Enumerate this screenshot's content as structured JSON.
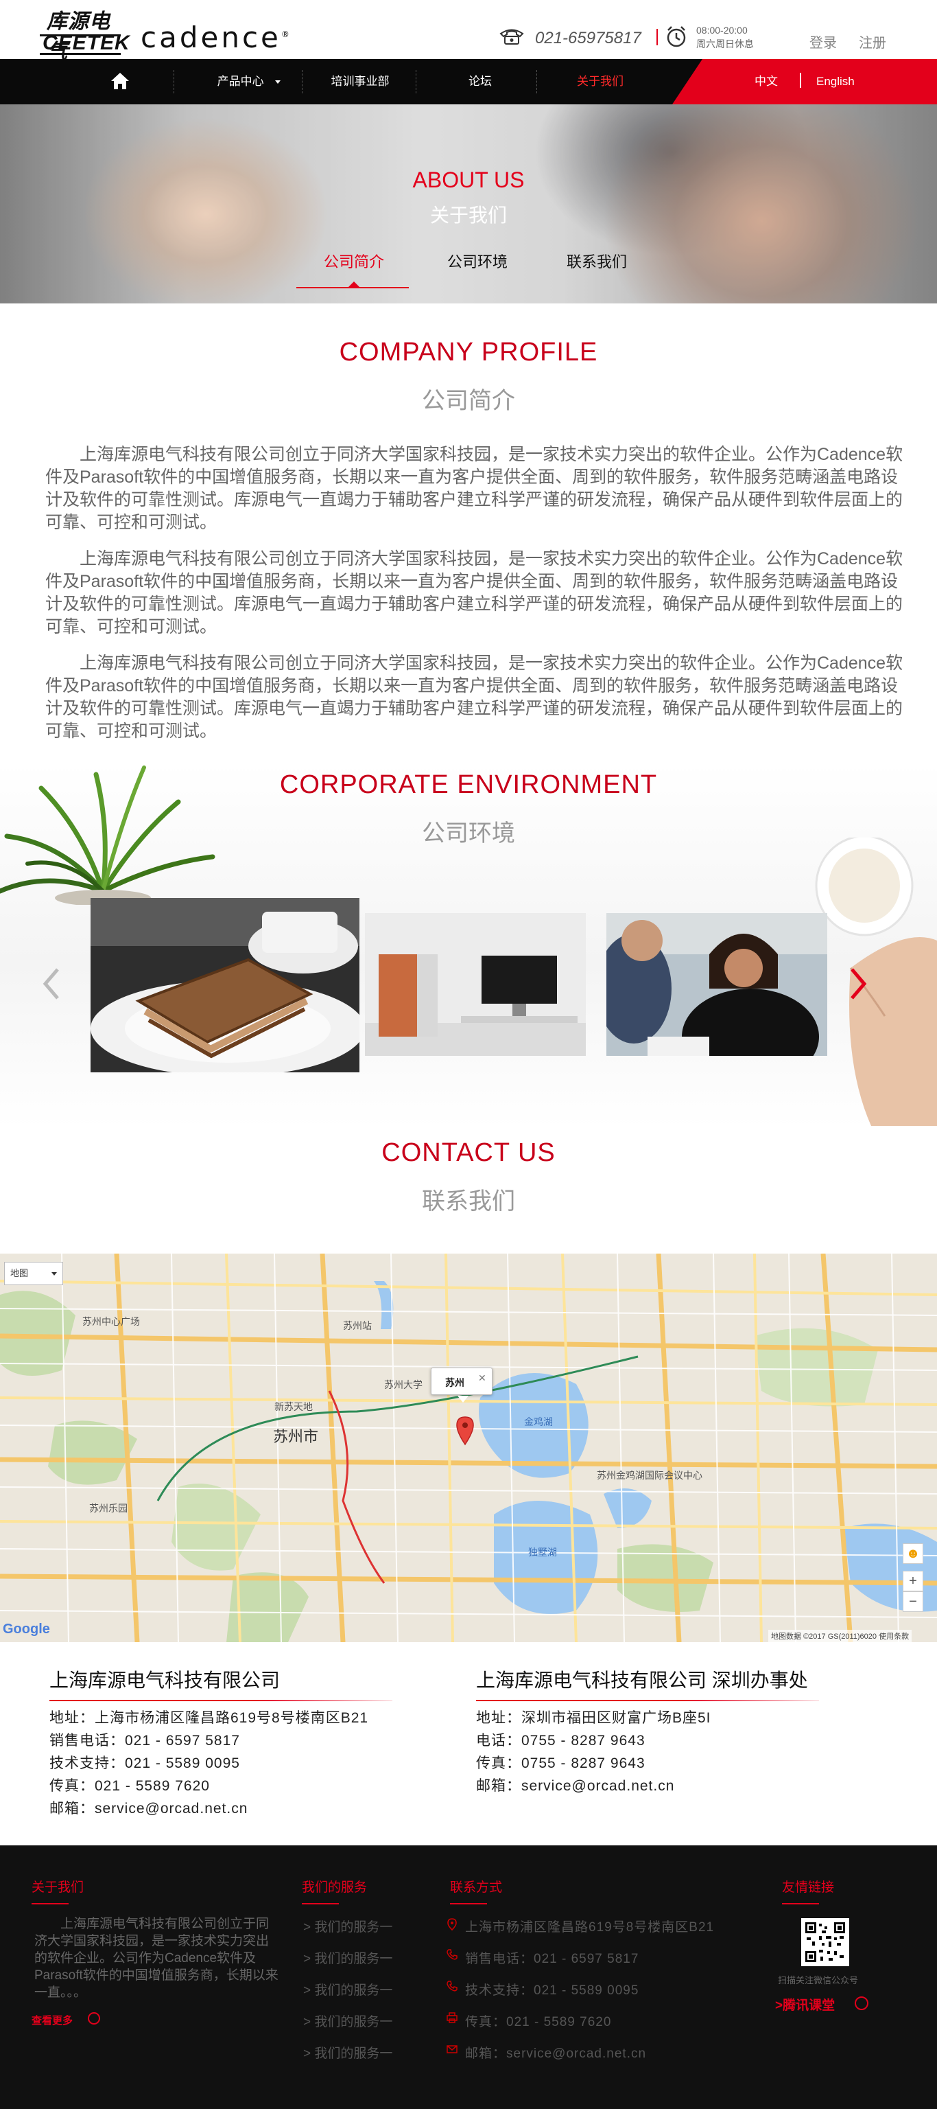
{
  "header": {
    "logo_cn": "库源电气",
    "logo_en": "CEETEK",
    "partner_logo": "cadence",
    "phone": "021-65975817",
    "hours_line1": "08:00-20:00",
    "hours_line2": "周六周日休息",
    "login": "登录",
    "register": "注册"
  },
  "nav": {
    "items": [
      {
        "label": "产品中心"
      },
      {
        "label": "培训事业部"
      },
      {
        "label": "论坛"
      },
      {
        "label": "关于我们"
      }
    ],
    "lang_zh": "中文",
    "lang_en": "English"
  },
  "hero": {
    "title_en": "ABOUT US",
    "title_cn": "关于我们",
    "tabs": [
      {
        "label": "公司简介"
      },
      {
        "label": "公司环境"
      },
      {
        "label": "联系我们"
      }
    ]
  },
  "profile": {
    "title_en": "COMPANY PROFILE",
    "title_cn": "公司简介",
    "paragraphs": [
      "上海库源电气科技有限公司创立于同济大学国家科技园，是一家技术实力突出的软件企业。公作为Cadence软件及Parasoft软件的中国增值服务商，长期以来一直为客户提供全面、周到的软件服务，软件服务范畴涵盖电路设计及软件的可靠性测试。库源电气一直竭力于辅助客户建立科学严谨的研发流程，确保产品从硬件到软件层面上的可靠、可控和可测试。",
      "上海库源电气科技有限公司创立于同济大学国家科技园，是一家技术实力突出的软件企业。公作为Cadence软件及Parasoft软件的中国增值服务商，长期以来一直为客户提供全面、周到的软件服务，软件服务范畴涵盖电路设计及软件的可靠性测试。库源电气一直竭力于辅助客户建立科学严谨的研发流程，确保产品从硬件到软件层面上的可靠、可控和可测试。",
      "上海库源电气科技有限公司创立于同济大学国家科技园，是一家技术实力突出的软件企业。公作为Cadence软件及Parasoft软件的中国增值服务商，长期以来一直为客户提供全面、周到的软件服务，软件服务范畴涵盖电路设计及软件的可靠性测试。库源电气一直竭力于辅助客户建立科学严谨的研发流程，确保产品从硬件到软件层面上的可靠、可控和可测试。"
    ]
  },
  "environment": {
    "title_en": "CORPORATE ENVIRONMENT",
    "title_cn": "公司环境"
  },
  "contact": {
    "title_en": "CONTACT US",
    "title_cn": "联系我们"
  },
  "map": {
    "type_select": "地图",
    "popup": "苏州",
    "logo": "Google",
    "copyright": "地图数据 ©2017 GS(2011)6020    使用条款",
    "labels": [
      "苏州市",
      "苏州站",
      "新苏天地",
      "苏州大学",
      "金鸡湖",
      "独墅湖",
      "苏州金鸡湖国际会议中心",
      "苏州乐园",
      "苏州中心广场"
    ]
  },
  "offices": [
    {
      "title": "上海库源电气科技有限公司",
      "lines": [
        "地址：上海市杨浦区隆昌路619号8号楼南区B21",
        "销售电话：021 - 6597 5817",
        "技术支持：021 - 5589 0095",
        "传真：021 - 5589 7620",
        "邮箱：service@orcad.net.cn"
      ]
    },
    {
      "title": "上海库源电气科技有限公司 深圳办事处",
      "lines": [
        "地址：深圳市福田区财富广场B座5I",
        "电话：0755 - 8287 9643",
        "传真：0755 - 8287 9643",
        "邮箱：service@orcad.net.cn"
      ]
    }
  ],
  "footer": {
    "about_title": "关于我们",
    "about_text": "上海库源电气科技有限公司创立于同济大学国家科技园，是一家技术实力突出的软件企业。公司作为Cadence软件及Parasoft软件的中国增值服务商，长期以来一直。。。",
    "more": "查看更多",
    "services_title": "我们的服务",
    "services": [
      "> 我们的服务一",
      "> 我们的服务一",
      "> 我们的服务一",
      "> 我们的服务一",
      "> 我们的服务一"
    ],
    "contact_title": "联系方式",
    "contact_lines": [
      "上海市杨浦区隆昌路619号8号楼南区B21",
      "销售电话：021 - 6597 5817",
      "技术支持：021 - 5589 0095",
      "传真：021 - 5589 7620",
      "邮箱：service@orcad.net.cn"
    ],
    "links_title": "友情链接",
    "qr_label": "扫描关注微信公众号",
    "tencent": ">腾讯课堂"
  },
  "colors": {
    "accent": "#e3001b",
    "nav_bg": "#0a0a0a",
    "footer_bg": "#111111"
  }
}
